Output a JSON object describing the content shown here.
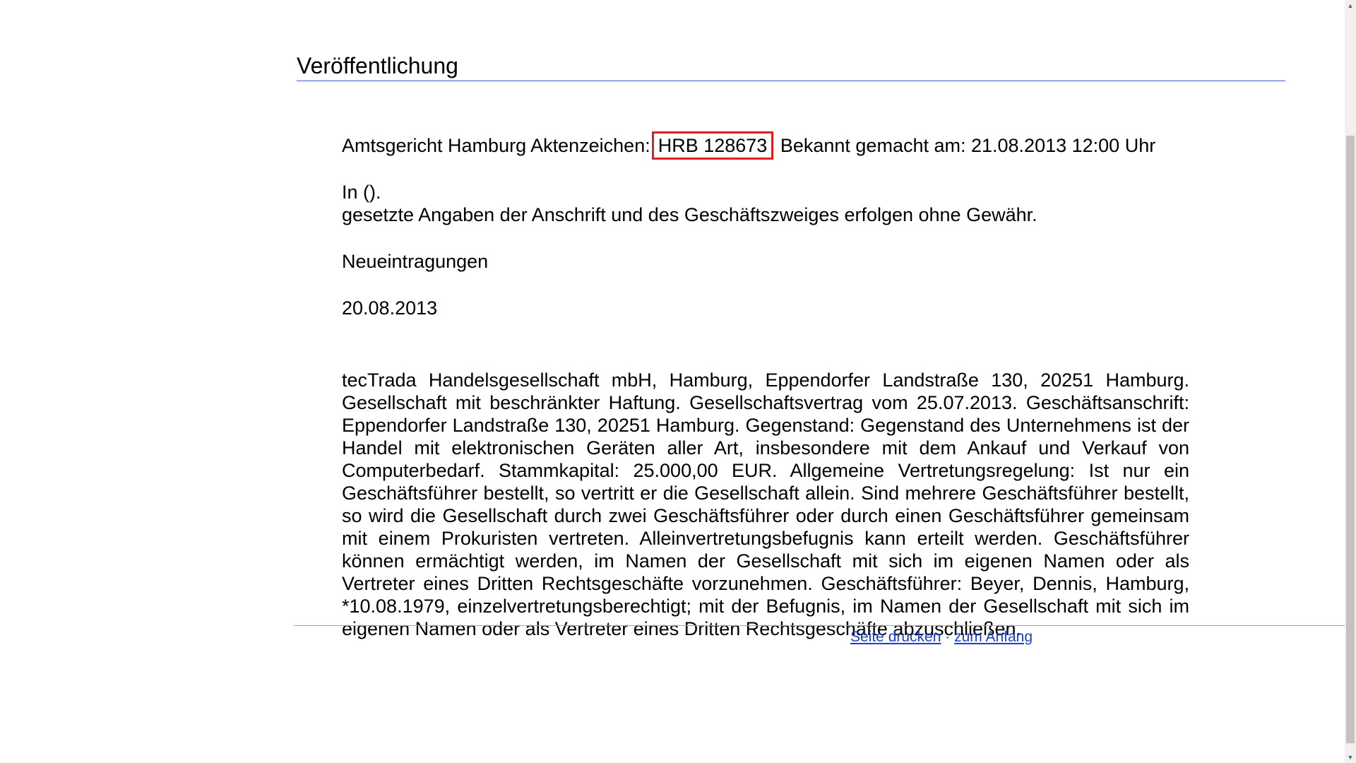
{
  "publication": {
    "title": "Veröffentlichung"
  },
  "header": {
    "court_prefix": "Amtsgericht Hamburg Aktenzeichen:",
    "reference": "HRB 128673",
    "announced": "Bekannt gemacht am: 21.08.2013 12:00 Uhr"
  },
  "intro": {
    "line1": "In ().",
    "line2": "gesetzte Angaben der Anschrift und des Geschäftszweiges erfolgen ohne Gewähr."
  },
  "section": {
    "type": "Neueintragungen",
    "date": "20.08.2013"
  },
  "entry": {
    "text": "tecTrada Handelsgesellschaft mbH, Hamburg, Eppendorfer Landstraße 130, 20251 Hamburg. Gesellschaft mit beschränkter Haftung. Gesellschaftsvertrag vom 25.07.2013. Geschäftsanschrift: Eppendorfer Landstraße 130, 20251 Hamburg. Gegenstand: Gegenstand des Unternehmens ist der Handel mit elektronischen Geräten aller Art, insbesondere mit dem Ankauf und Verkauf von Computerbedarf. Stammkapital: 25.000,00 EUR. Allgemeine Vertretungsregelung: Ist nur ein Geschäftsführer bestellt, so vertritt er die Gesellschaft allein. Sind mehrere Geschäftsführer bestellt, so wird die Gesellschaft durch zwei Geschäftsführer oder durch einen Geschäftsführer gemeinsam mit einem Prokuristen vertreten. Alleinvertretungsbefugnis kann erteilt werden. Geschäftsführer können ermächtigt werden, im Namen der Gesellschaft mit sich im eigenen Namen oder als Vertreter eines Dritten Rechtsgeschäfte vorzunehmen. Geschäftsführer: Beyer, Dennis, Hamburg, *10.08.1979, einzelvertretungsberechtigt; mit der Befugnis, im Namen der Gesellschaft mit sich im eigenen Namen oder als Vertreter eines Dritten Rechtsgeschäfte abzuschließen."
  },
  "footer": {
    "print_label": "Seite drucken",
    "separator": "·",
    "top_label": "zum Anfang"
  },
  "colors": {
    "highlight_border": "#e02020",
    "title_rule": "#3c5fc8",
    "link": "#1a3fd0"
  }
}
